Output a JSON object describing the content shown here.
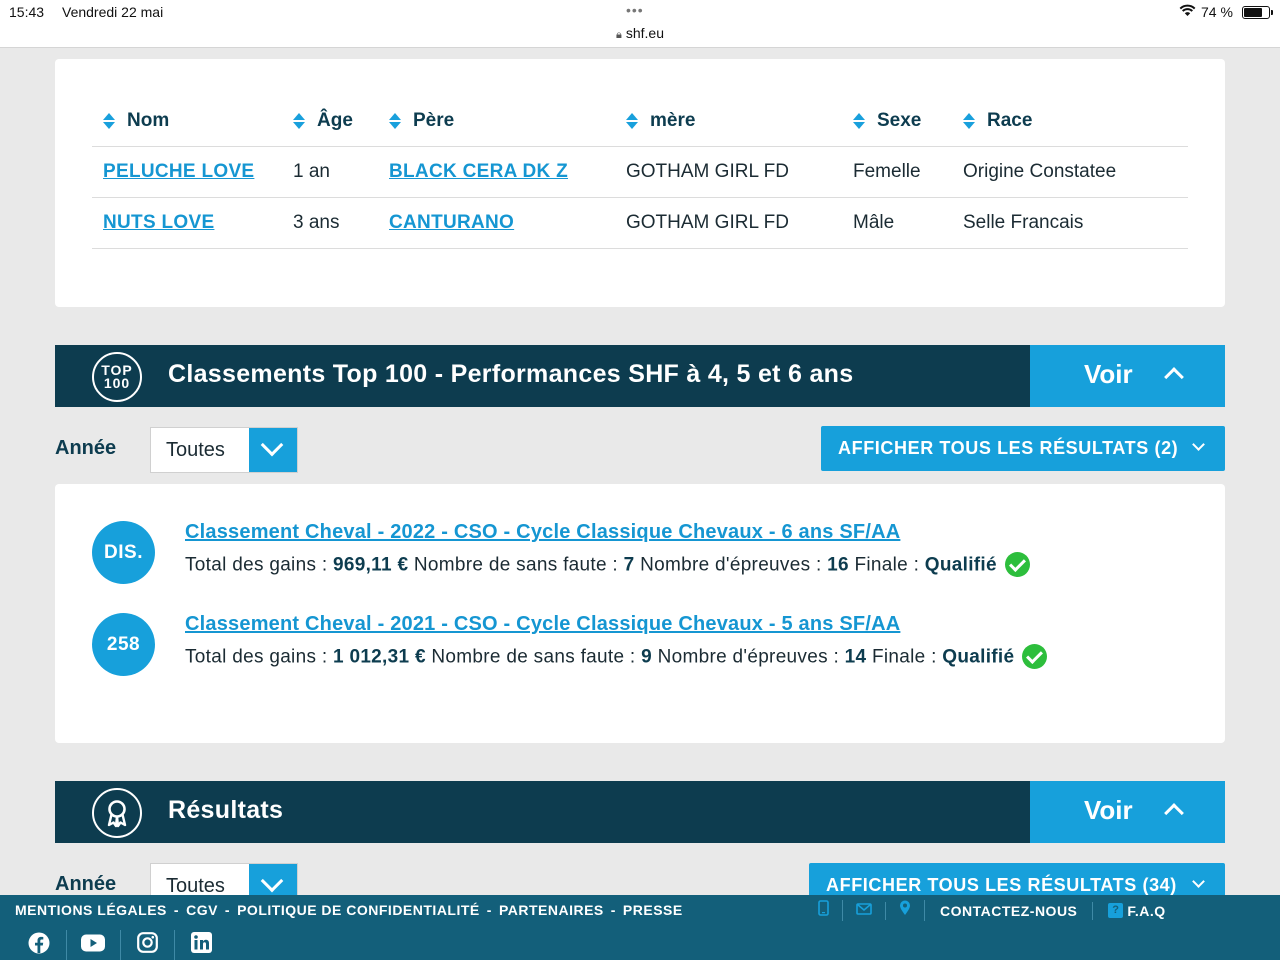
{
  "status_bar": {
    "time": "15:43",
    "date": "Vendredi 22 mai",
    "url": "shf.eu",
    "battery": "74 %",
    "battery_level": 0.74
  },
  "offspring_table": {
    "columns": [
      "Nom",
      "Âge",
      "Père",
      "mère",
      "Sexe",
      "Race"
    ],
    "rows": [
      {
        "nom": "PELUCHE LOVE",
        "age": "1 an",
        "pere": "BLACK CERA DK Z",
        "mere": "GOTHAM GIRL FD",
        "sexe": "Femelle",
        "race": "Origine Constatee"
      },
      {
        "nom": "NUTS LOVE",
        "age": "3 ans",
        "pere": "CANTURANO",
        "mere": "GOTHAM GIRL FD",
        "sexe": "Mâle",
        "race": "Selle Francais"
      }
    ]
  },
  "top100": {
    "icon_text_1": "TOP",
    "icon_text_2": "100",
    "title": "Classements Top 100 - Performances SHF à 4, 5 et 6 ans",
    "toggle_label": "Voir",
    "year_label": "Année",
    "year_value": "Toutes",
    "show_all_label": "AFFICHER TOUS LES RÉSULTATS (2)",
    "entries": [
      {
        "rank": "DIS.",
        "title": "Classement Cheval - 2022 - CSO - Cycle Classique Chevaux - 6 ans SF/AA",
        "gains_label": "Total des gains :",
        "gains": "969,11 €",
        "sans_faute_label": "Nombre de sans faute :",
        "sans_faute": "7",
        "epreuves_label": "Nombre d'épreuves :",
        "epreuves": "16",
        "finale_label": "Finale :",
        "finale": "Qualifié"
      },
      {
        "rank": "258",
        "title": "Classement Cheval - 2021 - CSO - Cycle Classique Chevaux - 5 ans SF/AA",
        "gains_label": "Total des gains :",
        "gains": "1 012,31 €",
        "sans_faute_label": "Nombre de sans faute :",
        "sans_faute": "9",
        "epreuves_label": "Nombre d'épreuves :",
        "epreuves": "14",
        "finale_label": "Finale :",
        "finale": "Qualifié"
      }
    ]
  },
  "resultats": {
    "title": "Résultats",
    "toggle_label": "Voir",
    "year_label": "Année",
    "year_value": "Toutes",
    "show_all_label": "AFFICHER TOUS LES RÉSULTATS (34)"
  },
  "footer": {
    "links": [
      "MENTIONS LÉGALES",
      "-",
      "CGV",
      "-",
      "POLITIQUE DE CONFIDENTIALITÉ",
      "-",
      "PARTENAIRES",
      "-",
      "PRESSE"
    ],
    "contact": "CONTACTEZ-NOUS",
    "faq": "F.A.Q",
    "faq_icon": "?",
    "social": [
      "facebook-icon",
      "youtube-icon",
      "instagram-icon",
      "linkedin-icon"
    ]
  },
  "colors": {
    "navy": "#0d3c4f",
    "accent": "#17a0db",
    "footer": "#135f7a",
    "check": "#2dbe3c"
  }
}
